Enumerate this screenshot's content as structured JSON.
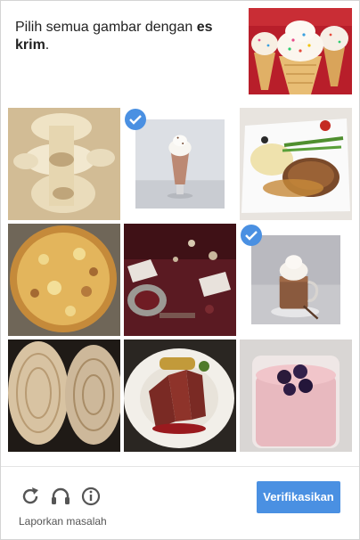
{
  "challenge": {
    "prompt_text": "Pilih semua gambar dengan",
    "prompt_target": "es krim",
    "prompt_end": ".",
    "sample_image": "ice-cream-cones"
  },
  "tiles": [
    {
      "subject": "vertebra-bone",
      "selected": false
    },
    {
      "subject": "milkshake-glass",
      "selected": true
    },
    {
      "subject": "plated-meat-dish",
      "selected": false
    },
    {
      "subject": "pizza",
      "selected": false
    },
    {
      "subject": "dining-table",
      "selected": false
    },
    {
      "subject": "hot-chocolate-cup",
      "selected": true
    },
    {
      "subject": "wood-slices",
      "selected": false
    },
    {
      "subject": "steak-plate",
      "selected": false
    },
    {
      "subject": "berry-yogurt",
      "selected": false
    }
  ],
  "footer": {
    "reload_icon": "reload-icon",
    "audio_icon": "headphones-icon",
    "info_icon": "info-icon",
    "report_label": "Laporkan masalah",
    "verify_label": "Verifikasikan"
  },
  "colors": {
    "accent": "#4a90e2",
    "check": "#4a90e2"
  }
}
